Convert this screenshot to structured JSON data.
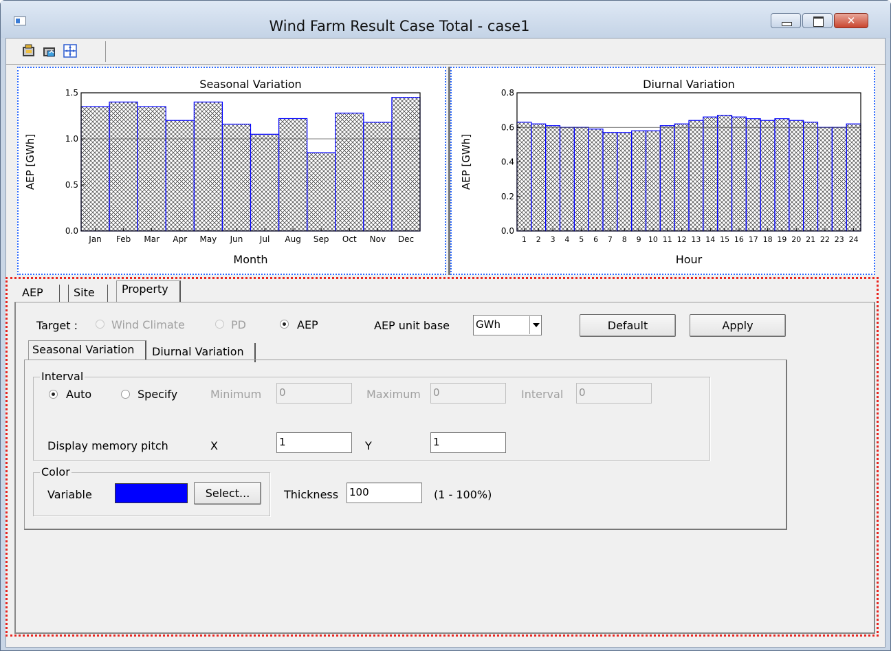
{
  "window": {
    "title": "Wind Farm Result Case Total - case1"
  },
  "toolbar": {
    "icons": [
      "open-icon",
      "save-icon",
      "fit-view-icon"
    ]
  },
  "chart_data": [
    {
      "type": "bar",
      "title": "Seasonal Variation",
      "xlabel": "Month",
      "ylabel": "AEP [GWh]",
      "ylim": [
        0,
        1.5
      ],
      "yticks": [
        "0.0",
        "0.5",
        "1.0",
        "1.5"
      ],
      "categories": [
        "Jan",
        "Feb",
        "Mar",
        "Apr",
        "May",
        "Jun",
        "Jul",
        "Aug",
        "Sep",
        "Oct",
        "Nov",
        "Dec"
      ],
      "values": [
        1.35,
        1.4,
        1.35,
        1.2,
        1.4,
        1.16,
        1.05,
        1.22,
        0.85,
        1.28,
        1.18,
        1.45
      ],
      "reference_line": 1.0,
      "bar_color": "#0000ff",
      "fill_pattern": "crosshatch"
    },
    {
      "type": "bar",
      "title": "Diurnal Variation",
      "xlabel": "Hour",
      "ylabel": "AEP [GWh]",
      "ylim": [
        0,
        0.8
      ],
      "yticks": [
        "0.0",
        "0.2",
        "0.4",
        "0.6",
        "0.8"
      ],
      "categories": [
        "1",
        "2",
        "3",
        "4",
        "5",
        "6",
        "7",
        "8",
        "9",
        "10",
        "11",
        "12",
        "13",
        "14",
        "15",
        "16",
        "17",
        "18",
        "19",
        "20",
        "21",
        "22",
        "23",
        "24"
      ],
      "values": [
        0.63,
        0.62,
        0.61,
        0.6,
        0.6,
        0.59,
        0.57,
        0.57,
        0.58,
        0.58,
        0.61,
        0.62,
        0.64,
        0.66,
        0.67,
        0.66,
        0.65,
        0.64,
        0.65,
        0.64,
        0.63,
        0.6,
        0.6,
        0.62
      ],
      "reference_line": 0.6,
      "bar_color": "#0000ff",
      "fill_pattern": "crosshatch"
    }
  ],
  "tabs": {
    "aep": "AEP",
    "site": "Site",
    "property": "Property"
  },
  "property": {
    "target_label": "Target :",
    "target_options": {
      "wind_climate": "Wind Climate",
      "pd": "PD",
      "aep": "AEP"
    },
    "aep_unit_label": "AEP unit base",
    "aep_unit_value": "GWh",
    "default_button": "Default",
    "apply_button": "Apply",
    "subtabs": {
      "seasonal": "Seasonal Variation",
      "diurnal": "Diurnal Variation"
    },
    "interval_group": "Interval",
    "auto_label": "Auto",
    "specify_label": "Specify",
    "minimum_label": "Minimum",
    "minimum_value": "0",
    "maximum_label": "Maximum",
    "maximum_value": "0",
    "interval_label": "Interval",
    "interval_value": "0",
    "memory_pitch_label": "Display memory pitch",
    "x_label": "X",
    "x_value": "1",
    "y_label": "Y",
    "y_value": "1",
    "color_group": "Color",
    "variable_label": "Variable",
    "variable_color": "#0000ff",
    "select_button": "Select...",
    "thickness_label": "Thickness",
    "thickness_value": "100",
    "thickness_range": "(1 - 100%)"
  }
}
